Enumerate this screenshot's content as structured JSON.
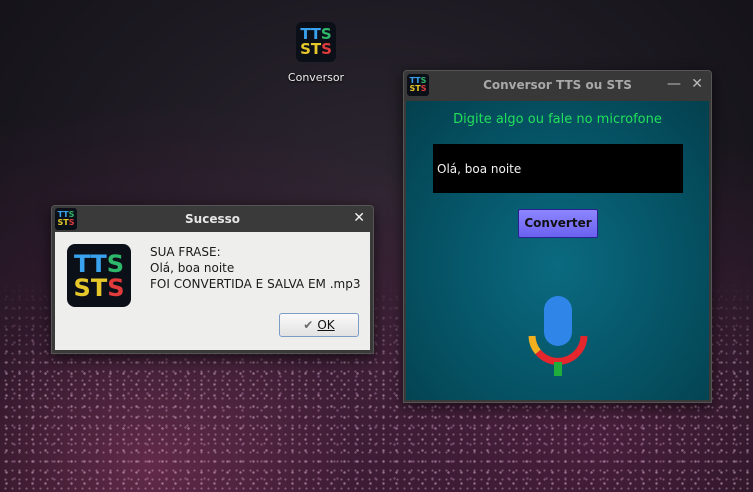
{
  "logo": {
    "row1": [
      "T",
      "T",
      "S"
    ],
    "row2": [
      "S",
      "T",
      "S"
    ]
  },
  "desktop": {
    "icon_label": "Conversor"
  },
  "main_window": {
    "title": "Conversor TTS ou STS",
    "minimize_symbol": "—",
    "close_symbol": "✕",
    "prompt": "Digite algo ou fale no microfone",
    "input_value": "Olá, boa noite",
    "convert_label": "Converter",
    "mic_icon": "microphone-icon",
    "bg_color": "#055466",
    "prompt_color": "#21e05a",
    "button_color": "#7f77ff"
  },
  "dialog": {
    "title": "Sucesso",
    "close_symbol": "✕",
    "message_lines": [
      "SUA FRASE:",
      "Olá, boa noite",
      "FOI CONVERTIDA E SALVA EM .mp3"
    ],
    "ok_label": "OK",
    "ok_icon": "checkmark-icon"
  }
}
